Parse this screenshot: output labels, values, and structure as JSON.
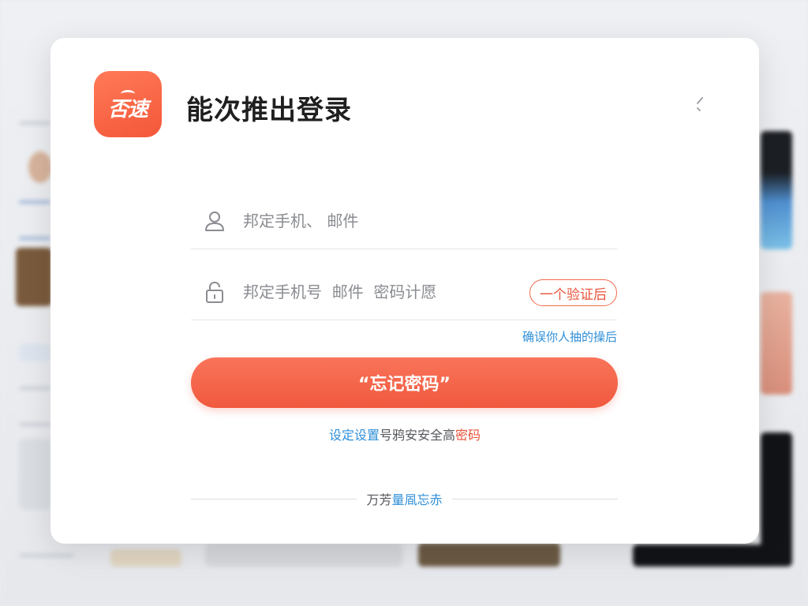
{
  "app": {
    "logo_text": "否速",
    "title": "能次推出登录"
  },
  "form": {
    "account_placeholder": "邦定手机、 邮件",
    "password_placeholder": "邦定手机号  邮件  密码计愿",
    "code_button_label": "一个验证后",
    "confirm_link": "确误你人抽的操后",
    "submit_label": "“忘记密码”"
  },
  "secondary": {
    "part_blue": "设定设置",
    "part_gray": "号鸦安安全高",
    "part_red": "密码"
  },
  "divider": {
    "part_gray": "万芳",
    "part_blue": "量凮忘赤"
  },
  "colors": {
    "accent": "#f0593e",
    "link": "#2f8fd8",
    "title": "#1f1f1f"
  },
  "icons": {
    "close": "chevron-left-icon",
    "account": "user-icon",
    "password": "lock-icon"
  }
}
